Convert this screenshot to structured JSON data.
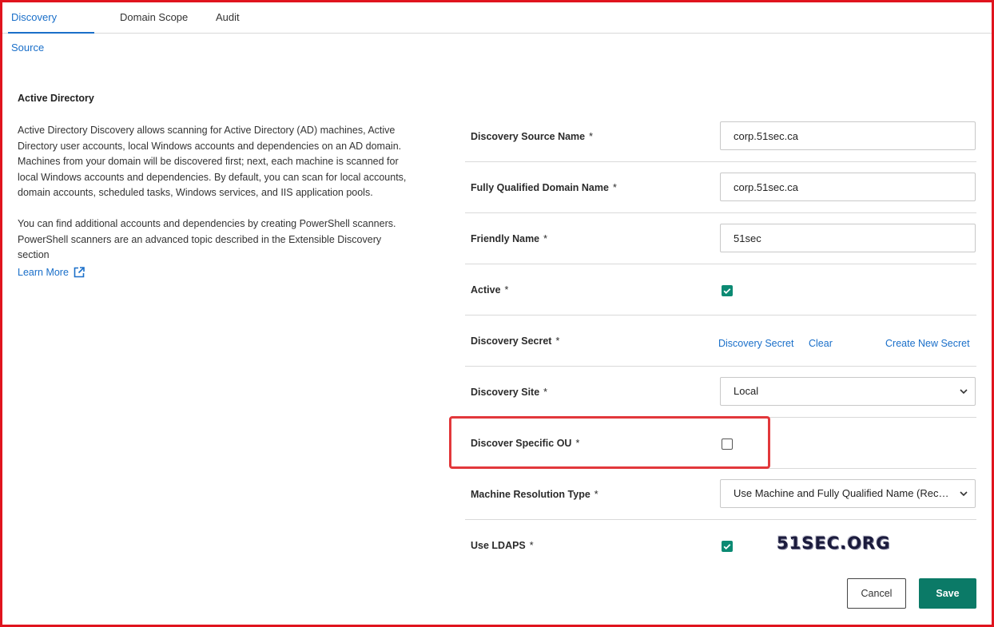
{
  "tabs": [
    {
      "label": "Discovery Source",
      "active": true
    },
    {
      "label": "Domain Scope",
      "active": false
    },
    {
      "label": "Audit",
      "active": false
    }
  ],
  "info": {
    "title": "Active Directory",
    "paragraph1": "Active Directory Discovery allows scanning for Active Directory (AD) machines, Active Directory user accounts, local Windows accounts and dependencies on an AD domain. Machines from your domain will be discovered first; next, each machine is scanned for local Windows accounts and dependencies. By default, you can scan for local accounts, domain accounts, scheduled tasks, Windows services, and IIS application pools.",
    "paragraph2": "You can find additional accounts and dependencies by creating PowerShell scanners. PowerShell scanners are an advanced topic described in the Extensible Discovery section",
    "learn_more": "Learn More"
  },
  "form": {
    "required_mark": "*",
    "source_name": {
      "label": "Discovery Source Name",
      "value": "corp.51sec.ca"
    },
    "fqdn": {
      "label": "Fully Qualified Domain Name",
      "value": "corp.51sec.ca"
    },
    "friendly_name": {
      "label": "Friendly Name",
      "value": "51sec"
    },
    "active": {
      "label": "Active",
      "checked": true
    },
    "secret": {
      "label": "Discovery Secret",
      "link_secret": "Discovery Secret",
      "link_clear": "Clear",
      "link_create": "Create New Secret"
    },
    "site": {
      "label": "Discovery Site",
      "value": "Local"
    },
    "specific_ou": {
      "label": "Discover Specific OU",
      "checked": false
    },
    "machine_resolution": {
      "label": "Machine Resolution Type",
      "value": "Use Machine and Fully Qualified Name (Rec…"
    },
    "ldaps": {
      "label": "Use LDAPS",
      "checked": true
    }
  },
  "watermark": "51SEC.ORG",
  "buttons": {
    "cancel": "Cancel",
    "save": "Save"
  },
  "colors": {
    "accent": "#1a6fc9",
    "primary_button": "#0b7a67",
    "checkbox": "#0b8a73",
    "highlight": "#e2383b",
    "frame": "#e0141e"
  }
}
